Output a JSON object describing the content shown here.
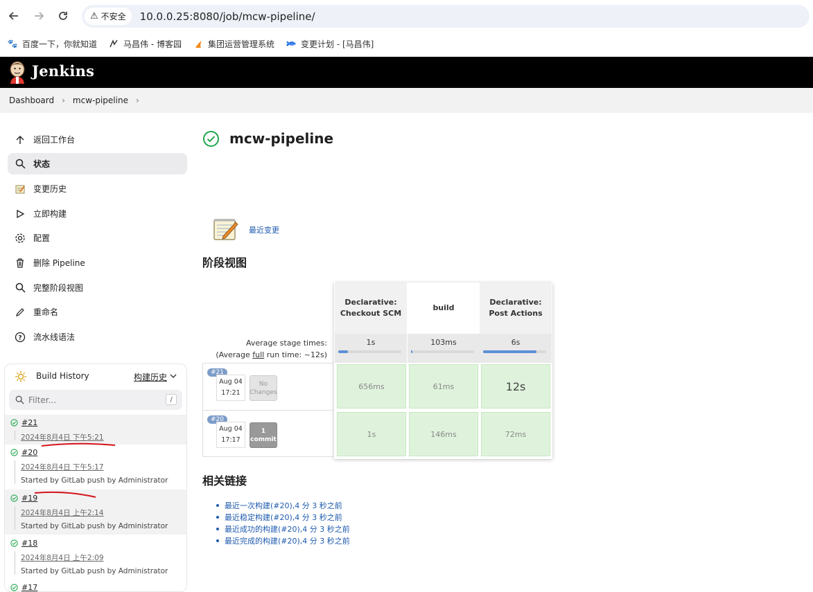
{
  "browser": {
    "security_label": "不安全",
    "url": "10.0.0.25:8080/job/mcw-pipeline/",
    "bookmarks": [
      {
        "label": "百度一下，你就知道",
        "icon": "baidu-icon"
      },
      {
        "label": "马昌伟 - 博客园",
        "icon": "cnblogs-icon"
      },
      {
        "label": "集团运营管理系统",
        "icon": "flame-icon"
      },
      {
        "label": "变更计划 - [马昌伟]",
        "icon": "confluence-icon"
      }
    ]
  },
  "header": {
    "title": "Jenkins"
  },
  "breadcrumb": [
    "Dashboard",
    "mcw-pipeline"
  ],
  "sidebar": {
    "items": [
      {
        "label": "返回工作台",
        "icon": "arrow-up-icon",
        "active": false
      },
      {
        "label": "状态",
        "icon": "search-icon",
        "active": true
      },
      {
        "label": "变更历史",
        "icon": "notepad-icon",
        "active": false
      },
      {
        "label": "立即构建",
        "icon": "play-icon",
        "active": false
      },
      {
        "label": "配置",
        "icon": "gear-icon",
        "active": false
      },
      {
        "label": "删除 Pipeline",
        "icon": "trash-icon",
        "active": false
      },
      {
        "label": "完整阶段视图",
        "icon": "search-icon",
        "active": false
      },
      {
        "label": "重命名",
        "icon": "pencil-icon",
        "active": false
      },
      {
        "label": "流水线语法",
        "icon": "help-icon",
        "active": false
      }
    ]
  },
  "build_history": {
    "title": "Build History",
    "link": "构建历史",
    "filter_placeholder": "Filter...",
    "filter_shortcut": "/",
    "builds": [
      {
        "number": "#21",
        "date": "2024年8月4日 下午5:21",
        "cause": ""
      },
      {
        "number": "#20",
        "date": "2024年8月4日 下午5:17",
        "cause": "Started by GitLab push by Administrator"
      },
      {
        "number": "#19",
        "date": "2024年8月4日 上午2:14",
        "cause": "Started by GitLab push by Administrator"
      },
      {
        "number": "#18",
        "date": "2024年8月4日 上午2:09",
        "cause": "Started by GitLab push by Administrator"
      },
      {
        "number": "#17",
        "date": "",
        "cause": ""
      }
    ]
  },
  "main": {
    "title": "mcw-pipeline",
    "recent_changes": "最近变更",
    "stage_view_heading": "阶段视图",
    "related_links_heading": "相关链接"
  },
  "stage_view": {
    "stages": [
      "Declarative: Checkout SCM",
      "build",
      "Declarative: Post Actions"
    ],
    "avg_label_1": "Average stage times:",
    "avg_label_2_pre": "(Average ",
    "avg_label_2_link": "full",
    "avg_label_2_post": " run time: ~12s)",
    "avg_times": [
      "1s",
      "103ms",
      "6s"
    ],
    "avg_fill": [
      0.15,
      0.02,
      0.85
    ],
    "runs": [
      {
        "badge": "#21",
        "date": "Aug 04",
        "time": "17:21",
        "changes_line1": "No",
        "changes_line2": "Changes",
        "has_changes": false,
        "durations": [
          "656ms",
          "61ms",
          "12s"
        ]
      },
      {
        "badge": "#20",
        "date": "Aug 04",
        "time": "17:17",
        "changes_line1": "1",
        "changes_line2": "commit",
        "has_changes": true,
        "durations": [
          "1s",
          "146ms",
          "72ms"
        ]
      }
    ]
  },
  "related_links": [
    "最近一次构建(#20),4 分 3 秒之前",
    "最近稳定构建(#20),4 分 3 秒之前",
    "最近成功的构建(#20),4 分 3 秒之前",
    "最近完成的构建(#20),4 分 3 秒之前"
  ]
}
